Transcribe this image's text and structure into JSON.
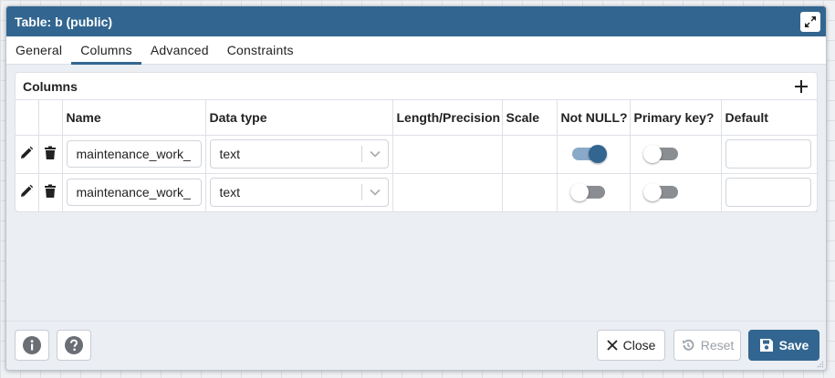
{
  "dialog": {
    "title": "Table: b (public)"
  },
  "tabs": [
    {
      "label": "General"
    },
    {
      "label": "Columns"
    },
    {
      "label": "Advanced"
    },
    {
      "label": "Constraints"
    }
  ],
  "active_tab": "Columns",
  "columns_panel": {
    "title": "Columns",
    "headers": [
      "Name",
      "Data type",
      "Length/Precision",
      "Scale",
      "Not NULL?",
      "Primary key?",
      "Default"
    ],
    "rows": [
      {
        "name": "maintenance_work_",
        "data_type": "text",
        "length": "",
        "scale": "",
        "not_null": true,
        "primary_key": false,
        "default": ""
      },
      {
        "name": "maintenance_work_",
        "data_type": "text",
        "length": "",
        "scale": "",
        "not_null": false,
        "primary_key": false,
        "default": ""
      }
    ]
  },
  "footer": {
    "close_label": "Close",
    "reset_label": "Reset",
    "save_label": "Save"
  },
  "colors": {
    "accent": "#326690",
    "toggle_on_track": "#8aa9c8",
    "toggle_off_track": "#8a8d92"
  }
}
